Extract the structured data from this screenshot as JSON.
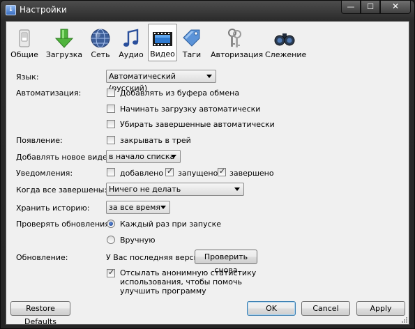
{
  "window": {
    "title": "Настройки"
  },
  "tabs": [
    {
      "label": "Общие",
      "icon": "switch-icon"
    },
    {
      "label": "Загрузка",
      "icon": "download-arrow-icon"
    },
    {
      "label": "Сеть",
      "icon": "globe-icon"
    },
    {
      "label": "Аудио",
      "icon": "music-note-icon"
    },
    {
      "label": "Видео",
      "icon": "film-icon"
    },
    {
      "label": "Таги",
      "icon": "tag-icon"
    },
    {
      "label": "Авторизация",
      "icon": "keys-icon"
    },
    {
      "label": "Слежение",
      "icon": "binoculars-icon"
    }
  ],
  "active_tab": "Видео",
  "form": {
    "language": {
      "label": "Язык:",
      "value": "Автоматический (русский)"
    },
    "automation": {
      "label": "Автоматизация:",
      "options": [
        {
          "label": "Добавлять из буфера обмена",
          "checked": false
        },
        {
          "label": "Начинать загрузку автоматически",
          "checked": false
        },
        {
          "label": "Убирать завершенные автоматически",
          "checked": false
        }
      ]
    },
    "appearance": {
      "label": "Появление:",
      "option": {
        "label": "закрывать в трей",
        "checked": false
      }
    },
    "add_video": {
      "label": "Добавлять новое видео:",
      "value": "в начало списка"
    },
    "notifications": {
      "label": "Уведомления:",
      "options": [
        {
          "label": "добавлено",
          "checked": false
        },
        {
          "label": "запущено",
          "checked": true
        },
        {
          "label": "завершено",
          "checked": true
        }
      ]
    },
    "when_done": {
      "label": "Когда все завершены:",
      "value": "Ничего не делать"
    },
    "history": {
      "label": "Хранить историю:",
      "value": "за все время"
    },
    "check_updates": {
      "label": "Проверять обновления:",
      "options": [
        {
          "label": "Каждый раз при запуске",
          "selected": true
        },
        {
          "label": "Вручную",
          "selected": false
        }
      ]
    },
    "update": {
      "label": "Обновление:",
      "status": "У Вас последняя версия",
      "check_button": "Проверить снова"
    },
    "statistics": {
      "lines": [
        "Отсылать анонимную статистику",
        "использования, чтобы помочь",
        "улучшить программу"
      ],
      "checked": true
    }
  },
  "buttons": {
    "restore": "Restore Defaults",
    "ok": "OK",
    "cancel": "Cancel",
    "apply": "Apply"
  },
  "caption_buttons": {
    "minimize": "—",
    "maximize": "☐",
    "close": "✕"
  }
}
